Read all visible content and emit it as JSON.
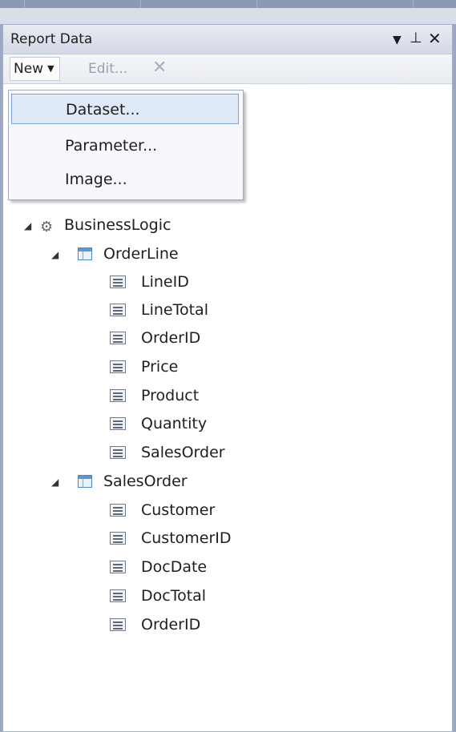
{
  "panel": {
    "title": "Report Data",
    "title_icons": [
      "dropdown-arrow-icon",
      "pin-icon",
      "close-icon"
    ]
  },
  "toolbar": {
    "new_label": "New",
    "edit_label": "Edit...",
    "delete_icon": "delete-icon"
  },
  "dropdown_menu": {
    "items": [
      "Dataset...",
      "Parameter...",
      "Image..."
    ],
    "selected": "Dataset..."
  },
  "tree": {
    "data_source": "BusinessLogic",
    "datasets": [
      {
        "name": "OrderLine",
        "fields": [
          "LineID",
          "LineTotal",
          "OrderID",
          "Price",
          "Product",
          "Quantity",
          "SalesOrder"
        ]
      },
      {
        "name": "SalesOrder",
        "fields": [
          "Customer",
          "CustomerID",
          "DocDate",
          "DocTotal",
          "OrderID"
        ]
      }
    ]
  }
}
